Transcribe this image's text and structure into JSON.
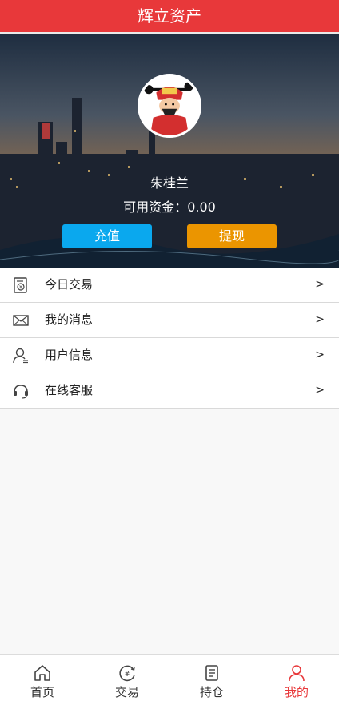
{
  "header": {
    "title": "辉立资产"
  },
  "profile": {
    "username": "朱桂兰",
    "balance_label": "可用资金：",
    "balance_value": "0.00",
    "avatar_icon": "fortune-god-avatar"
  },
  "actions": {
    "recharge_label": "充值",
    "withdraw_label": "提现"
  },
  "menu": {
    "items": [
      {
        "label": "今日交易",
        "icon": "receipt-icon",
        "arrow": ">"
      },
      {
        "label": "我的消息",
        "icon": "mail-icon",
        "arrow": ">"
      },
      {
        "label": "用户信息",
        "icon": "user-icon",
        "arrow": ">"
      },
      {
        "label": "在线客服",
        "icon": "headset-icon",
        "arrow": ">"
      }
    ]
  },
  "tabbar": {
    "items": [
      {
        "label": "首页",
        "icon": "home-icon"
      },
      {
        "label": "交易",
        "icon": "yen-exchange-icon"
      },
      {
        "label": "持仓",
        "icon": "document-icon"
      },
      {
        "label": "我的",
        "icon": "profile-icon"
      }
    ],
    "active_index": 3
  },
  "colors": {
    "accent": "#e8383a",
    "recharge": "#0aa8ee",
    "withdraw": "#eb9500"
  }
}
